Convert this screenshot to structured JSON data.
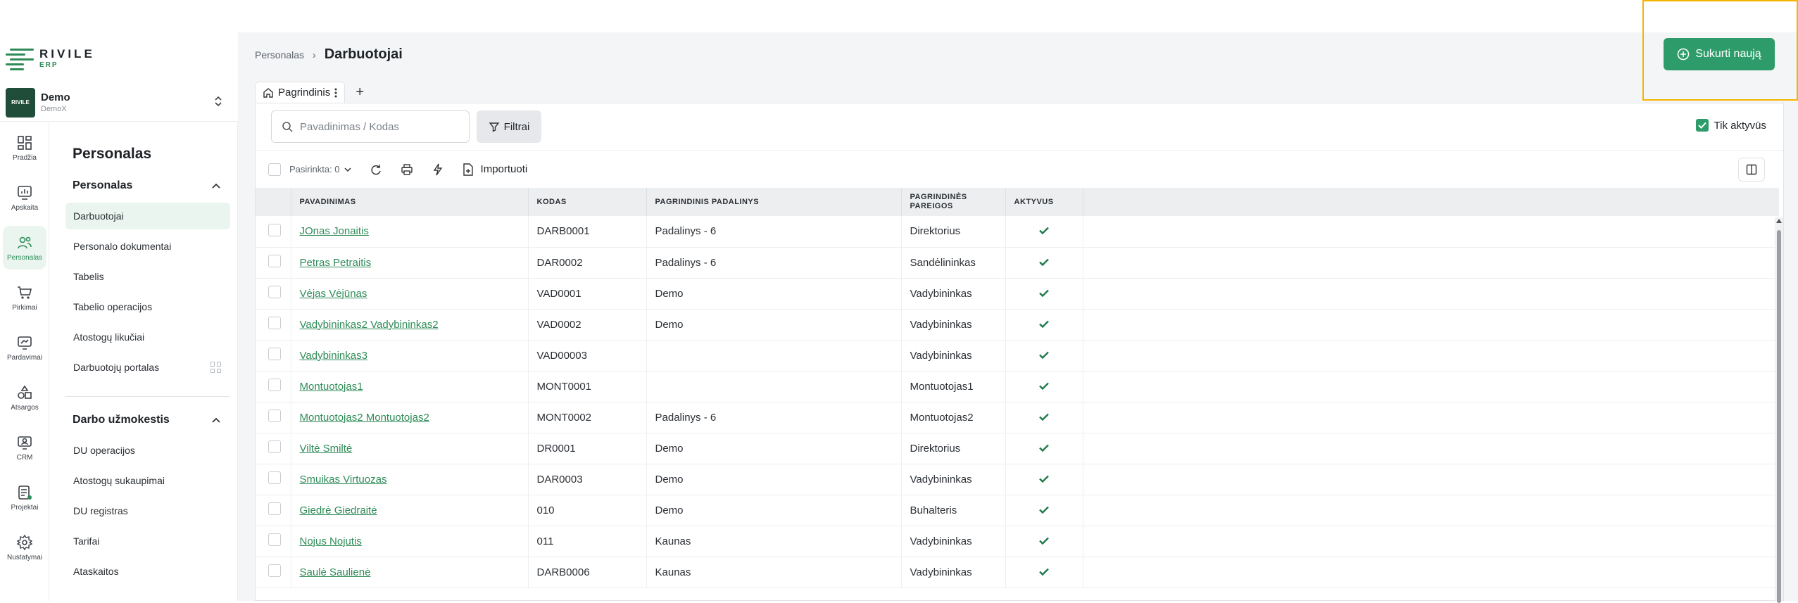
{
  "brand": {
    "name": "RIVILE",
    "sub": "ERP"
  },
  "company": {
    "name": "Demo",
    "sub": "DemoX",
    "logo_text": "RIVILE"
  },
  "rail": [
    {
      "label": "Pradžia",
      "icon": "dashboard-icon"
    },
    {
      "label": "Apskaita",
      "icon": "chart-icon"
    },
    {
      "label": "Personalas",
      "icon": "people-icon",
      "active": true
    },
    {
      "label": "Pirkimai",
      "icon": "cart-icon"
    },
    {
      "label": "Pardavimai",
      "icon": "sales-icon"
    },
    {
      "label": "Atsargos",
      "icon": "shapes-icon"
    },
    {
      "label": "CRM",
      "icon": "crm-icon"
    },
    {
      "label": "Projektai",
      "icon": "projects-icon"
    },
    {
      "label": "Nustatymai",
      "icon": "gear-icon"
    }
  ],
  "subnav": {
    "title": "Personalas",
    "groups": [
      {
        "label": "Personalas",
        "items": [
          "Darbuotojai",
          "Personalo dokumentai",
          "Tabelis",
          "Tabelio operacijos",
          "Atostogų likučiai",
          "Darbuotojų portalas"
        ]
      },
      {
        "label": "Darbo užmokestis",
        "items": [
          "DU operacijos",
          "Atostogų sukaupimai",
          "DU registras",
          "Tarifai",
          "Ataskaitos"
        ]
      }
    ]
  },
  "breadcrumb": {
    "parent": "Personalas",
    "current": "Darbuotojai"
  },
  "create_button": "Sukurti naują",
  "tab": {
    "label": "Pagrindinis"
  },
  "search": {
    "placeholder": "Pavadinimas / Kodas"
  },
  "filter_button": "Filtrai",
  "only_active": "Tik aktyvūs",
  "toolbar": {
    "selected": "Pasirinkta: 0",
    "import": "Importuoti"
  },
  "table": {
    "headers": [
      "PAVADINIMAS",
      "KODAS",
      "PAGRINDINIS PADALINYS",
      "PAGRINDINĖS PAREIGOS",
      "AKTYVUS"
    ],
    "rows": [
      [
        "JOnas Jonaitis",
        "DARB0001",
        "Padalinys - 6",
        "Direktorius"
      ],
      [
        "Petras Petraitis",
        "DAR0002",
        "Padalinys - 6",
        "Sandėlininkas"
      ],
      [
        "Vėjas Vėjūnas",
        "VAD0001",
        "Demo",
        "Vadybininkas"
      ],
      [
        "Vadybininkas2 Vadybininkas2",
        "VAD0002",
        "Demo",
        "Vadybininkas"
      ],
      [
        "Vadybininkas3",
        "VAD00003",
        "",
        "Vadybininkas"
      ],
      [
        "Montuotojas1",
        "MONT0001",
        "",
        "Montuotojas1"
      ],
      [
        "Montuotojas2 Montuotojas2",
        "MONT0002",
        "Padalinys - 6",
        "Montuotojas2"
      ],
      [
        "Viltė Smiltė",
        "DR0001",
        "Demo",
        "Direktorius"
      ],
      [
        "Smuikas Virtuozas",
        "DAR0003",
        "Demo",
        "Vadybininkas"
      ],
      [
        "Giedrė Giedraitė",
        "010",
        "Demo",
        "Buhalteris"
      ],
      [
        "Nojus Nojutis",
        "011",
        "Kaunas",
        "Vadybininkas"
      ],
      [
        "Saulė Saulienė",
        "DARB0006",
        "Kaunas",
        "Vadybininkas"
      ]
    ]
  }
}
